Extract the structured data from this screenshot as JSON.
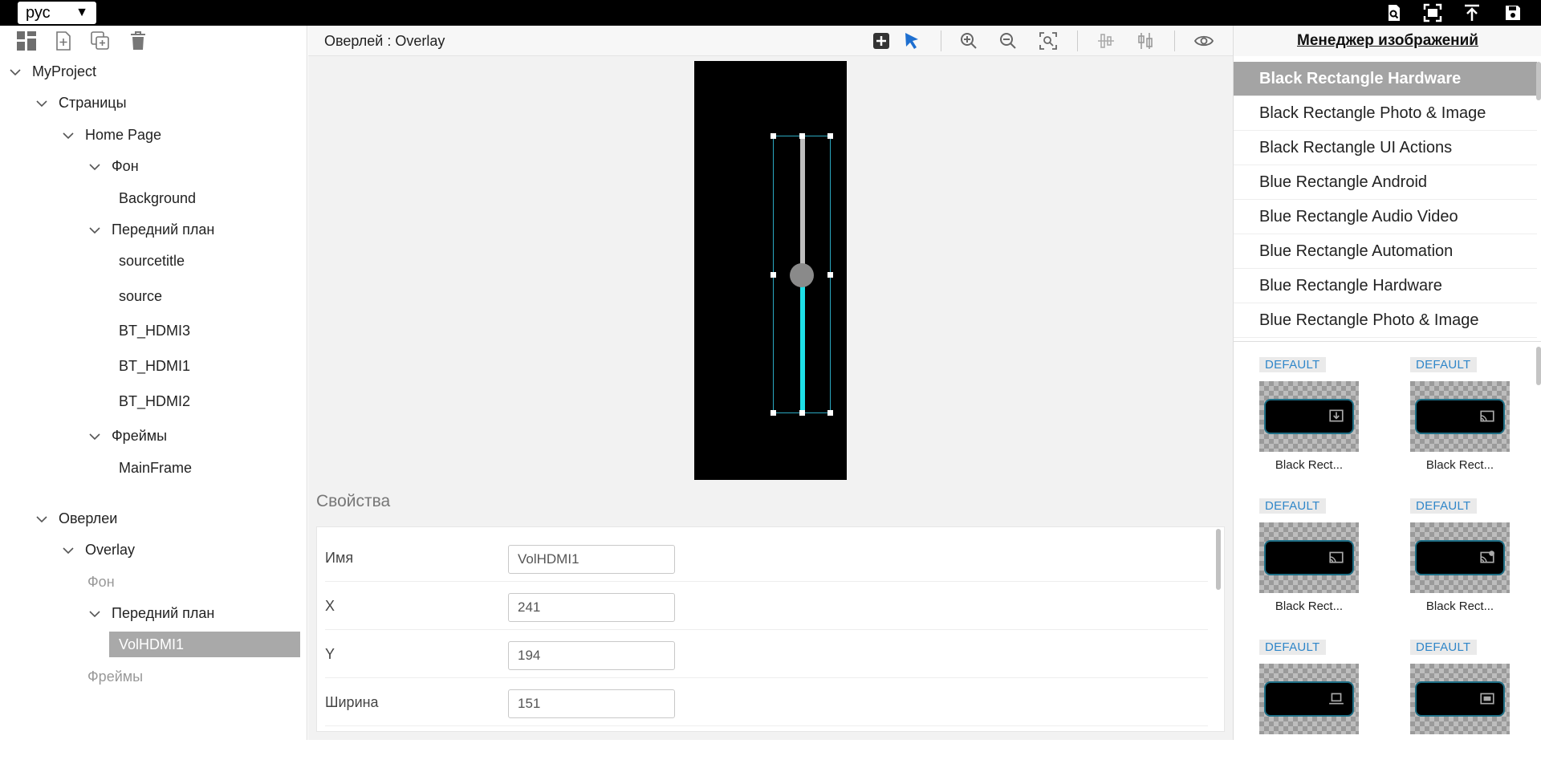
{
  "topbar": {
    "language": "рус",
    "icons": [
      "search-doc-icon",
      "fullscreen-icon",
      "upload-icon",
      "save-icon"
    ]
  },
  "left_toolbar": {
    "icons": [
      "dashboard-icon",
      "new-page-icon",
      "duplicate-icon",
      "trash-icon"
    ]
  },
  "tree": [
    {
      "label": "MyProject",
      "level": 0,
      "chevron": true
    },
    {
      "label": "Страницы",
      "level": 1,
      "chevron": true
    },
    {
      "label": "Home Page",
      "level": 2,
      "chevron": true
    },
    {
      "label": "Фон",
      "level": 3,
      "chevron": true
    },
    {
      "label": "Background",
      "level": 4,
      "chevron": false
    },
    {
      "label": "Передний план",
      "level": 3,
      "chevron": true
    },
    {
      "label": "sourcetitle",
      "level": 4,
      "chevron": false
    },
    {
      "label": "source",
      "level": 4,
      "chevron": false
    },
    {
      "label": "BT_HDMI3",
      "level": 4,
      "chevron": false
    },
    {
      "label": "BT_HDMI1",
      "level": 4,
      "chevron": false
    },
    {
      "label": "BT_HDMI2",
      "level": 4,
      "chevron": false
    },
    {
      "label": "Фреймы",
      "level": 3,
      "chevron": true
    },
    {
      "label": "MainFrame",
      "level": 4,
      "chevron": false
    },
    {
      "label": "Оверлеи",
      "level": 1,
      "chevron": true
    },
    {
      "label": "Overlay",
      "level": 2,
      "chevron": true
    },
    {
      "label": "Фон",
      "level": 3,
      "chevron": false,
      "dim": true
    },
    {
      "label": "Передний план",
      "level": 3,
      "chevron": true
    },
    {
      "label": "VolHDMI1",
      "level": 4,
      "chevron": false,
      "selected": true
    },
    {
      "label": "Фреймы",
      "level": 3,
      "chevron": false,
      "dim": true
    }
  ],
  "center": {
    "title": "Оверлей : Overlay",
    "toolbar_icons": [
      "add-icon",
      "pointer-icon",
      "zoom-in-icon",
      "zoom-out-icon",
      "zoom-fit-icon",
      "align-horizontal-icon",
      "align-vertical-icon",
      "eye-icon"
    ]
  },
  "properties": {
    "title": "Свойства",
    "rows": [
      {
        "label": "Имя",
        "value": "VolHDMI1"
      },
      {
        "label": "X",
        "value": "241"
      },
      {
        "label": "Y",
        "value": "194"
      },
      {
        "label": "Ширина",
        "value": "151"
      }
    ]
  },
  "image_manager": {
    "title": "Менеджер изображений",
    "categories": [
      "Black Rectangle Hardware",
      "Black Rectangle Photo & Image",
      "Black Rectangle UI Actions",
      "Blue Rectangle Android",
      "Blue Rectangle Audio Video",
      "Blue Rectangle Automation",
      "Blue Rectangle Hardware",
      "Blue Rectangle Photo & Image"
    ],
    "active_category": 0,
    "thumbnails": [
      {
        "badge": "DEFAULT",
        "label": "Black Rect...",
        "icon": "download-icon"
      },
      {
        "badge": "DEFAULT",
        "label": "Black Rect...",
        "icon": "cast-icon"
      },
      {
        "badge": "DEFAULT",
        "label": "Black Rect...",
        "icon": "cast-icon"
      },
      {
        "badge": "DEFAULT",
        "label": "Black Rect...",
        "icon": "cast-connected-icon"
      },
      {
        "badge": "DEFAULT",
        "label": "",
        "icon": "laptop-icon"
      },
      {
        "badge": "DEFAULT",
        "label": "",
        "icon": "screen-cast-icon"
      }
    ]
  },
  "colors": {
    "slider_top": "#bdbdbd",
    "slider_bottom": "#1ee0e8",
    "selection_bg": "#a9a9a9",
    "badge_text": "#2f86c9"
  }
}
